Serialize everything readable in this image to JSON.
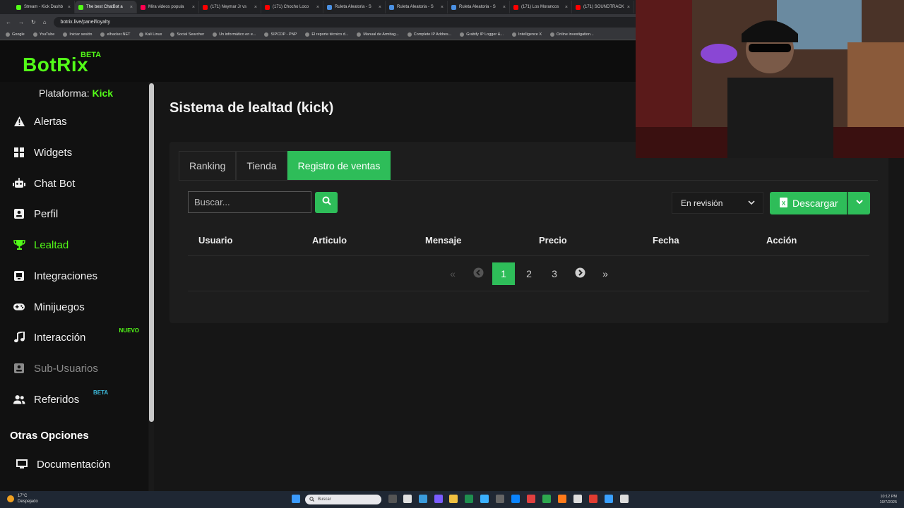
{
  "browser": {
    "tabs": [
      {
        "label": "Stream - Kick Dashb",
        "color": "#53fc18",
        "active": false
      },
      {
        "label": "The best ChatBot a",
        "color": "#53fc18",
        "active": true
      },
      {
        "label": "Mira videos popula",
        "color": "#ff0050",
        "active": false
      },
      {
        "label": "(171) Neymar Jr vs",
        "color": "#ff0000",
        "active": false
      },
      {
        "label": "(171) Chocho Loco",
        "color": "#ff0000",
        "active": false
      },
      {
        "label": "Ruleta Aleatoria - S",
        "color": "#4a90e2",
        "active": false
      },
      {
        "label": "Ruleta Aleatoria - S",
        "color": "#4a90e2",
        "active": false
      },
      {
        "label": "Ruleta Aleatoria - S",
        "color": "#4a90e2",
        "active": false
      },
      {
        "label": "(171) Los Morancos",
        "color": "#ff0000",
        "active": false
      },
      {
        "label": "(171) SOUNDTRACK",
        "color": "#ff0000",
        "active": false
      }
    ],
    "url": "botrix.live/panel/loyalty",
    "bookmarks": [
      "Google",
      "YouTube",
      "Iniciar sesión",
      "elhacker.NET",
      "Kali Linux",
      "Social Searcher",
      "Un informático en e...",
      "SIPCOP - PNP",
      "El reporte técnico d...",
      "Manual de Armitag...",
      "Complete IP Addres...",
      "Grabify IP Logger &...",
      "Intelligence X",
      "Online investigation..."
    ]
  },
  "app": {
    "logo": "BotRix",
    "logo_badge": "BETA",
    "platform_label": "Plataforma:",
    "platform_value": "Kick",
    "accent": "#53fc18",
    "button_color": "#2ebd59"
  },
  "sidebar": {
    "items": [
      {
        "label": "Alertas",
        "icon": "warning-icon"
      },
      {
        "label": "Widgets",
        "icon": "grid-icon"
      },
      {
        "label": "Chat Bot",
        "icon": "robot-icon"
      },
      {
        "label": "Perfil",
        "icon": "profile-card-icon"
      },
      {
        "label": "Lealtad",
        "icon": "trophy-icon",
        "active": true
      },
      {
        "label": "Integraciones",
        "icon": "integrations-icon"
      },
      {
        "label": "Minijuegos",
        "icon": "gamepad-icon"
      },
      {
        "label": "Interacción",
        "icon": "music-icon",
        "badge": "NUEVO"
      },
      {
        "label": "Sub-Usuarios",
        "icon": "sub-users-icon",
        "disabled": true
      },
      {
        "label": "Referidos",
        "icon": "users-icon",
        "badge": "BETA"
      }
    ],
    "other_heading": "Otras Opciones",
    "docs_label": "Documentación"
  },
  "main": {
    "title": "Sistema de lealtad (kick)",
    "tabs": [
      "Ranking",
      "Tienda",
      "Registro de ventas"
    ],
    "active_tab": 2,
    "search_placeholder": "Buscar...",
    "status_filter": "En revisión",
    "download_label": "Descargar",
    "columns": [
      "Usuario",
      "Articulo",
      "Mensaje",
      "Precio",
      "Fecha",
      "Acción"
    ],
    "pagination": {
      "pages": [
        "1",
        "2",
        "3"
      ],
      "current": 1
    }
  },
  "taskbar": {
    "temp": "17°C",
    "weather": "Despejado",
    "search_placeholder": "Buscar",
    "time": "10:12 PM",
    "date": "10/7/2025"
  }
}
